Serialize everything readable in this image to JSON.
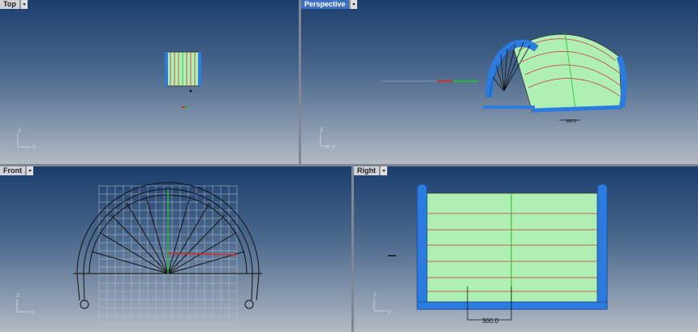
{
  "viewports": {
    "top": {
      "title": "Top",
      "active": false,
      "axes": [
        "y",
        "x"
      ]
    },
    "perspective": {
      "title": "Perspective",
      "active": true,
      "axes": [
        "z",
        "x",
        "y"
      ]
    },
    "front": {
      "title": "Front",
      "active": false,
      "axes": [
        "z",
        "x"
      ]
    },
    "right": {
      "title": "Right",
      "active": false,
      "axes": [
        "z",
        "y"
      ]
    }
  },
  "dimension": {
    "right_label": "300.0",
    "persp_label": "300.0"
  },
  "colors": {
    "surface": "#aef0b4",
    "frame": "#2c7ce0",
    "axis_x": "#d03030",
    "axis_y": "#22bb33",
    "wire": "#111111"
  }
}
